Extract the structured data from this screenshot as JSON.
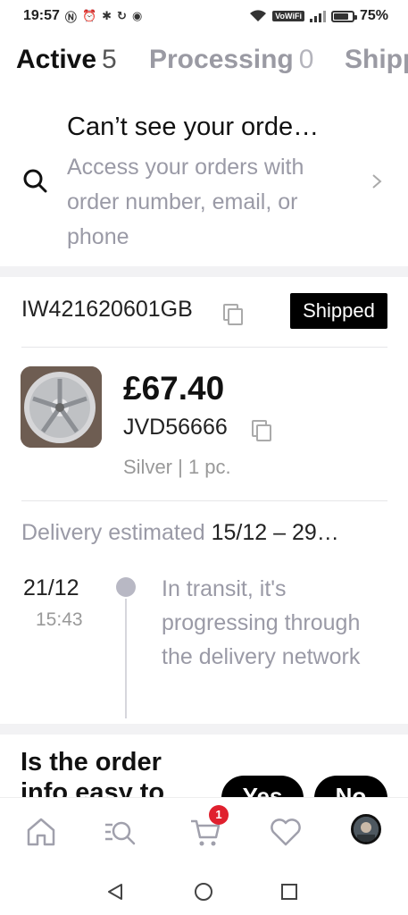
{
  "status_bar": {
    "time": "19:57",
    "battery": "75%",
    "vowifi": "VoWiFi"
  },
  "tabs": [
    {
      "label": "Active",
      "count": "5"
    },
    {
      "label": "Processing",
      "count": "0"
    },
    {
      "label": "Shipp",
      "count": ""
    }
  ],
  "search": {
    "title": "Can’t see your orde…",
    "description": "Access your orders with order number, email, or phone"
  },
  "order": {
    "number": "IW421620601GB",
    "status": "Shipped",
    "price": "£67.40",
    "sku": "JVD56666",
    "variant": "Silver | 1 pc.",
    "delivery_label": "Delivery estimated",
    "delivery_dates": "15/12 – 29…",
    "timeline": [
      {
        "date": "21/12",
        "time": "15:43",
        "text": "In transit, it's progressing through the delivery network"
      }
    ]
  },
  "feedback": {
    "question": "Is the order info easy to",
    "yes_label": "Yes",
    "no_label": "No"
  },
  "bottom_nav": {
    "cart_badge": "1"
  }
}
